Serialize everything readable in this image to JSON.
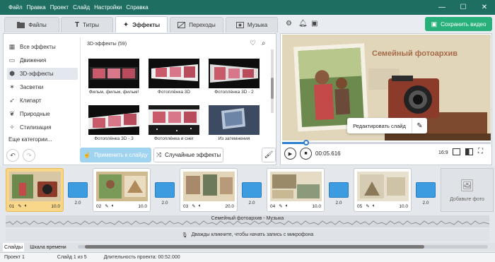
{
  "menu": [
    "Файл",
    "Правка",
    "Проект",
    "Слайд",
    "Настройки",
    "Справка"
  ],
  "tabs": [
    {
      "label": "Файлы",
      "icon": "folder-icon"
    },
    {
      "label": "Титры",
      "icon": "text-icon"
    },
    {
      "label": "Эффекты",
      "icon": "magic-wand-icon"
    },
    {
      "label": "Переходы",
      "icon": "transition-icon"
    },
    {
      "label": "Музыка",
      "icon": "music-icon"
    }
  ],
  "save_label": "Сохранить видео",
  "sidebar": [
    {
      "label": "Все эффекты",
      "icon": "grid-icon"
    },
    {
      "label": "Движения",
      "icon": "film-icon"
    },
    {
      "label": "3D-эффекты",
      "icon": "cube-icon"
    },
    {
      "label": "Засветки",
      "icon": "flare-icon"
    },
    {
      "label": "Клипарт",
      "icon": "rocket-icon"
    },
    {
      "label": "Природные",
      "icon": "leaf-icon"
    },
    {
      "label": "Стилизация",
      "icon": "sparkle-icon"
    },
    {
      "label": "Еще категории..."
    }
  ],
  "section_title": "3D-эффекты (59)",
  "effects": [
    "Фильм, фильм, фильм!",
    "Фотоплёнка 3D",
    "Фотоплёнка 3D - 2",
    "Фотоплёнка 3D - 3",
    "Фотоплёнка и снег",
    "Из затемнения"
  ],
  "apply_label": "Применить к слайду",
  "random_label": "Случайные эффекты",
  "preview": {
    "title": "Семейный фотоархив",
    "edit_label": "Редактировать слайд",
    "time": "00:05.616",
    "aspect": "16:9"
  },
  "slides": [
    {
      "num": "01",
      "dur": "10.0"
    },
    {
      "num": "02",
      "dur": "10.0"
    },
    {
      "num": "03",
      "dur": "20.0"
    },
    {
      "num": "04",
      "dur": "10.0"
    },
    {
      "num": "05",
      "dur": "10.0"
    }
  ],
  "transitions": [
    "2.0",
    "2.0",
    "2.0",
    "2.0",
    "2.0"
  ],
  "add_photo_label": "Добавьте фото",
  "music_label": "Семейный фотоархив - Музыка",
  "mic_label": "Дважды кликните, чтобы начать запись с микрофона",
  "bottom_tabs": [
    "Слайды",
    "Шкала времени"
  ],
  "status": {
    "project": "Проект 1",
    "slide": "Слайд 1 из 5",
    "duration": "Длительность проекта: 00:52.000"
  },
  "colors": {
    "titlebar": "#1f6e62",
    "accent_green": "#28b07a",
    "accent_blue": "#2d7fd0",
    "active_slide": "#f8d78b"
  }
}
